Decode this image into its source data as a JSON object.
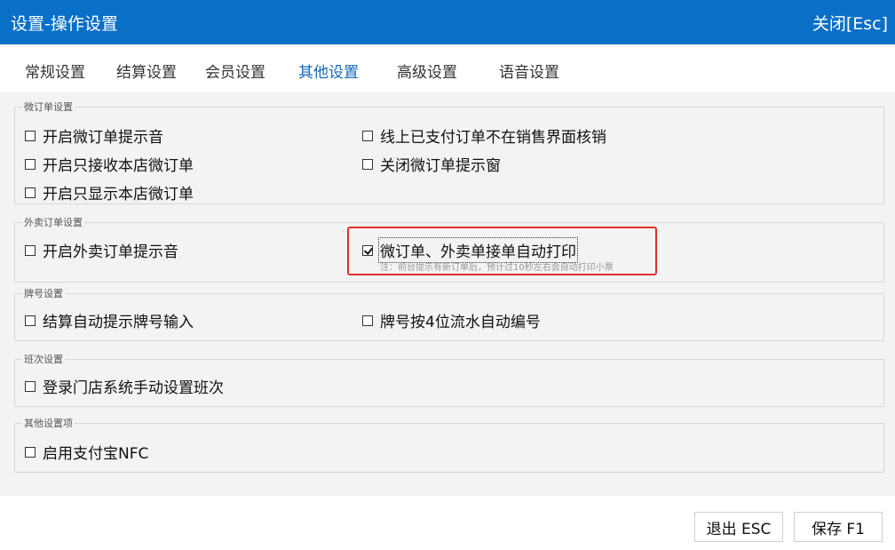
{
  "window": {
    "title": "设置-操作设置",
    "close_label": "关闭[Esc]"
  },
  "tabs": [
    {
      "label": "常规设置",
      "active": false
    },
    {
      "label": "结算设置",
      "active": false
    },
    {
      "label": "会员设置",
      "active": false
    },
    {
      "label": "其他设置",
      "active": true
    },
    {
      "label": "高级设置",
      "active": false
    },
    {
      "label": "语音设置",
      "active": false
    }
  ],
  "groups": {
    "micro_order": {
      "legend": "微订单设置",
      "options": [
        {
          "label": "开启微订单提示音",
          "checked": false
        },
        {
          "label": "线上已支付订单不在销售界面核销",
          "checked": false
        },
        {
          "label": "开启只接收本店微订单",
          "checked": false
        },
        {
          "label": "关闭微订单提示窗",
          "checked": false
        },
        {
          "label": "开启只显示本店微订单",
          "checked": false
        }
      ]
    },
    "takeout": {
      "legend": "外卖订单设置",
      "options": [
        {
          "label": "开启外卖订单提示音",
          "checked": false
        },
        {
          "label": "微订单、外卖单接单自动打印",
          "checked": true
        }
      ],
      "note": "注：前台提示有新订单后，预计过10秒左右会自动打印小票"
    },
    "plate": {
      "legend": "牌号设置",
      "options": [
        {
          "label": "结算自动提示牌号输入",
          "checked": false
        },
        {
          "label": "牌号按4位流水自动编号",
          "checked": false
        }
      ]
    },
    "shift": {
      "legend": "班次设置",
      "options": [
        {
          "label": "登录门店系统手动设置班次",
          "checked": false
        }
      ]
    },
    "other": {
      "legend": "其他设置项",
      "options": [
        {
          "label": "启用支付宝NFC",
          "checked": false
        }
      ]
    }
  },
  "buttons": {
    "exit_label": "退出 ESC",
    "save_label": "保存 F1"
  },
  "colors": {
    "titlebar": "#0a6fc7",
    "active_tab": "#1467b8",
    "highlight": "#e0302a"
  }
}
